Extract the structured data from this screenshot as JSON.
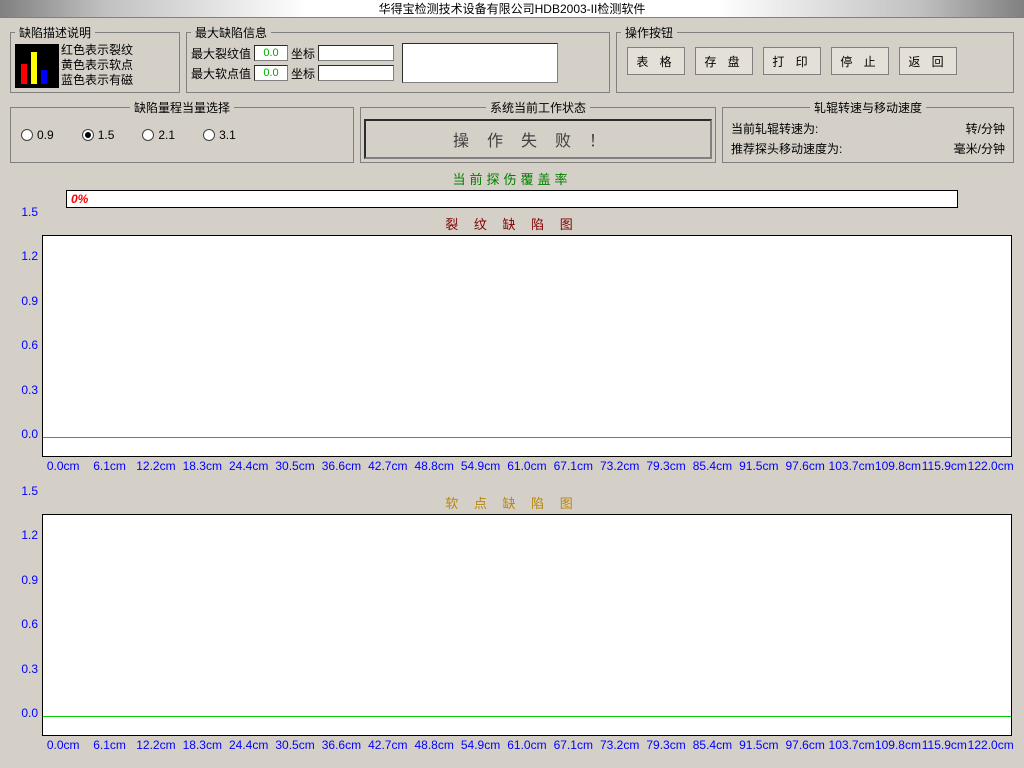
{
  "title": "华得宝检测技术设备有限公司HDB2003-II检测软件",
  "groups": {
    "desc": "缺陷描述说明",
    "maxinfo": "最大缺陷信息",
    "ops": "操作按钮",
    "range": "缺陷量程当量选择",
    "status": "系统当前工作状态",
    "speed": "轧辊转速与移动速度"
  },
  "desc": {
    "red": "红色表示裂纹",
    "yellow": "黄色表示软点",
    "blue": "蓝色表示有磁"
  },
  "maxinfo": {
    "crack_label": "最大裂纹值",
    "soft_label": "最大软点值",
    "crack_val": "0.0",
    "soft_val": "0.0",
    "coord_label": "坐标"
  },
  "buttons": {
    "table": "表 格",
    "save": "存 盘",
    "print": "打 印",
    "stop": "停 止",
    "back": "返 回"
  },
  "radios": [
    "0.9",
    "1.5",
    "2.1",
    "3.1"
  ],
  "radio_selected": "1.5",
  "status_text": "操作失败！",
  "speed": {
    "line1_label": "当前轧辊转速为:",
    "line1_unit": "转/分钟",
    "line2_label": "推荐探头移动速度为:",
    "line2_unit": "毫米/分钟"
  },
  "coverage": {
    "title": "当前探伤覆盖率",
    "value": "0%"
  },
  "chart_data": [
    {
      "title": "裂 纹 缺 陷 图",
      "type": "line",
      "yticks": [
        "1.5",
        "1.2",
        "0.9",
        "0.6",
        "0.3",
        "0.0"
      ],
      "xticks": [
        "0.0cm",
        "6.1cm",
        "12.2cm",
        "18.3cm",
        "24.4cm",
        "30.5cm",
        "36.6cm",
        "42.7cm",
        "48.8cm",
        "54.9cm",
        "61.0cm",
        "67.1cm",
        "73.2cm",
        "79.3cm",
        "85.4cm",
        "91.5cm",
        "97.6cm",
        "103.7cm",
        "109.8cm",
        "115.9cm",
        "122.0cm"
      ],
      "green_level": 0.12
    },
    {
      "title": "软 点 缺 陷 图",
      "type": "line",
      "yticks": [
        "1.5",
        "1.2",
        "0.9",
        "0.6",
        "0.3",
        "0.0"
      ],
      "xticks": [
        "0.0cm",
        "6.1cm",
        "12.2cm",
        "18.3cm",
        "24.4cm",
        "30.5cm",
        "36.6cm",
        "42.7cm",
        "48.8cm",
        "54.9cm",
        "61.0cm",
        "67.1cm",
        "73.2cm",
        "79.3cm",
        "85.4cm",
        "91.5cm",
        "97.6cm",
        "103.7cm",
        "109.8cm",
        "115.9cm",
        "122.0cm"
      ],
      "green_level": 0.12
    }
  ]
}
